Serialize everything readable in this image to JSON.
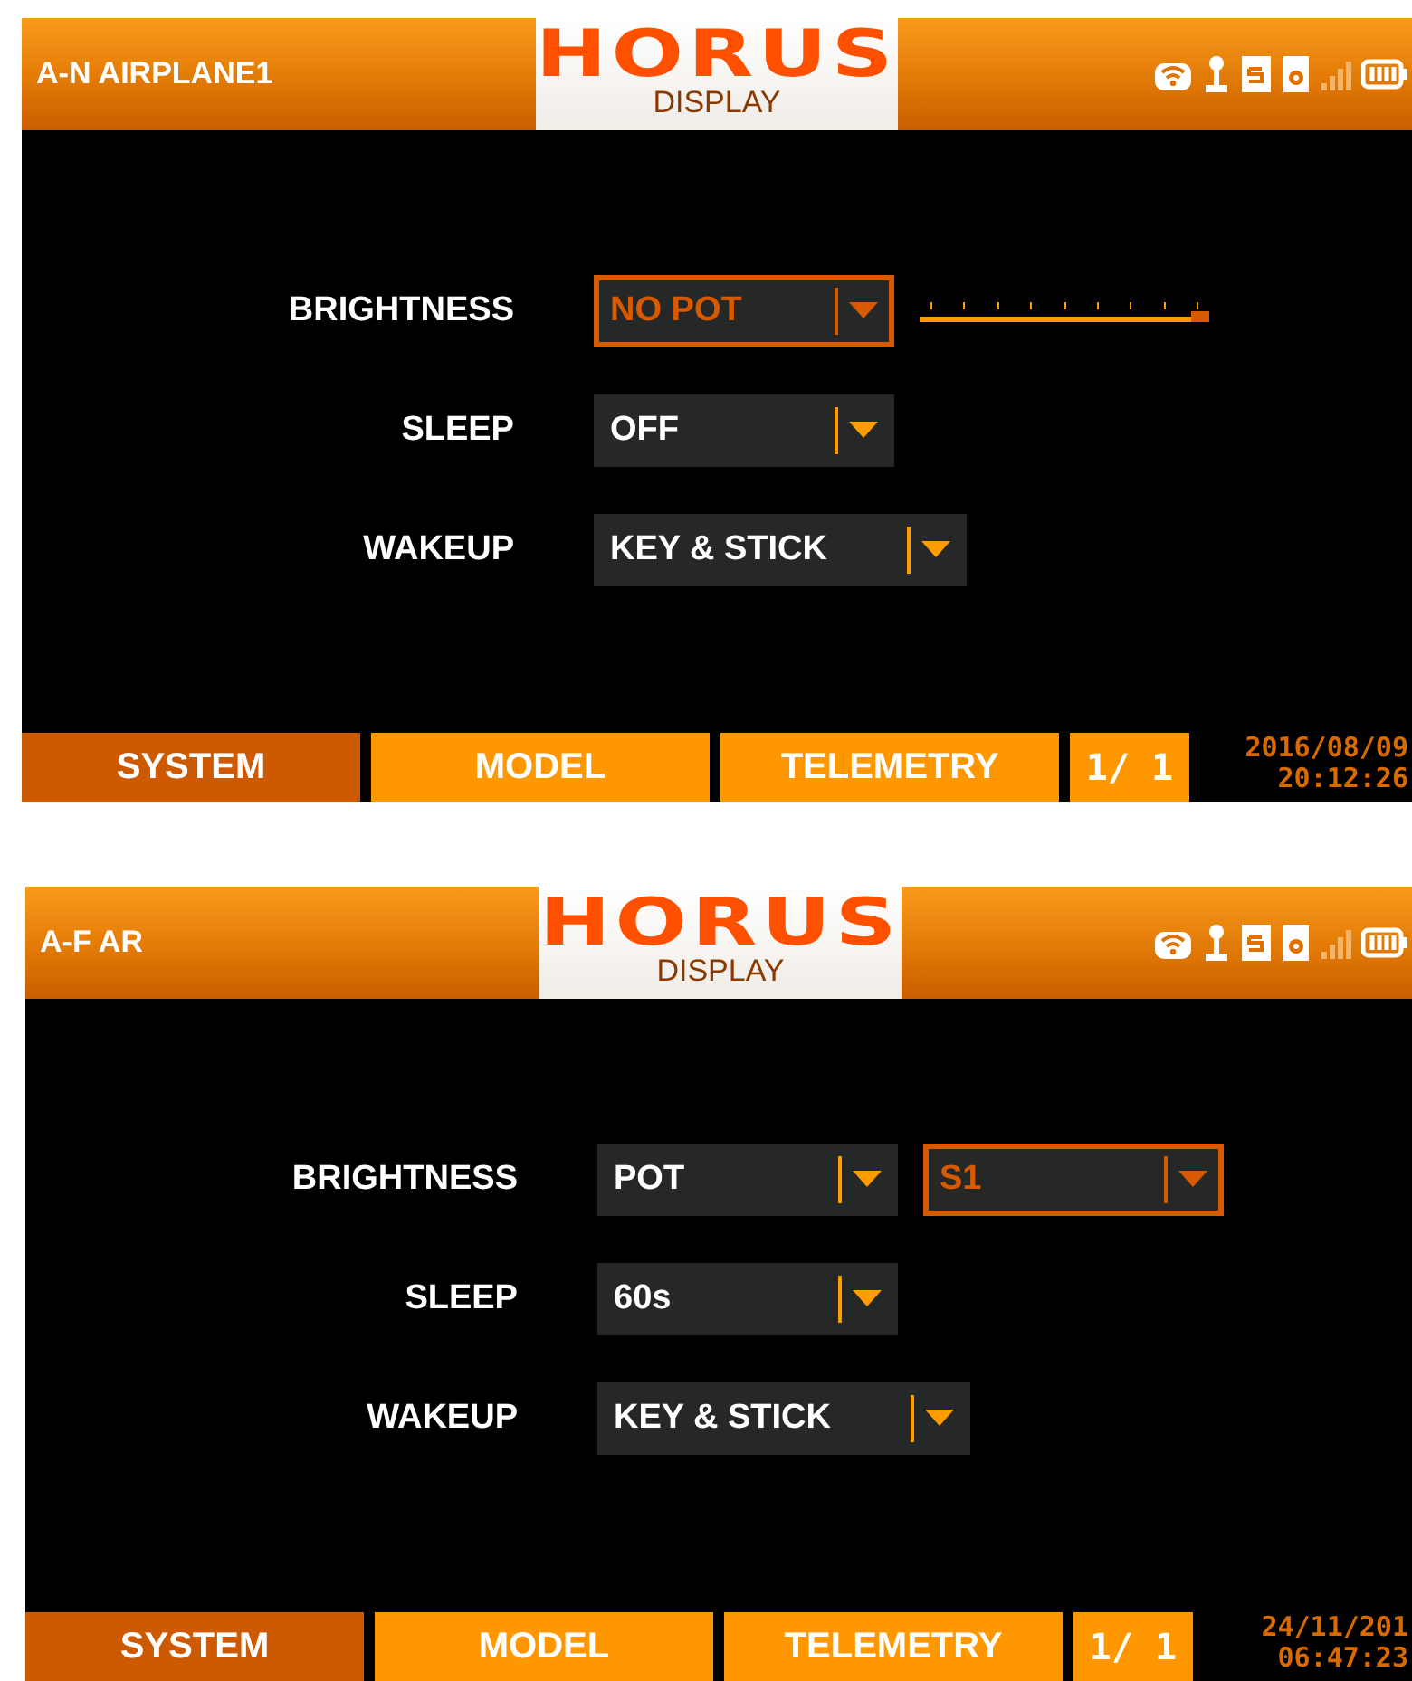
{
  "screens": [
    {
      "model_name": "A-N AIRPLANE1",
      "logo": "HORUS",
      "page_title": "DISPLAY",
      "settings": [
        {
          "label": "BRIGHTNESS",
          "controls": [
            {
              "kind": "dropdown",
              "value": "NO POT",
              "focused": true
            },
            {
              "kind": "slider",
              "level": 1
            }
          ]
        },
        {
          "label": "SLEEP",
          "controls": [
            {
              "kind": "dropdown",
              "value": "OFF",
              "focused": false
            }
          ]
        },
        {
          "label": "WAKEUP",
          "controls": [
            {
              "kind": "dropdown",
              "value": "KEY & STICK",
              "focused": false
            }
          ]
        }
      ],
      "tabs": [
        {
          "label": "SYSTEM",
          "selected": true
        },
        {
          "label": "MODEL",
          "selected": false
        },
        {
          "label": "TELEMETRY",
          "selected": false
        }
      ],
      "page": "1/ 1",
      "date": "2016/08/09",
      "time": "20:12:26"
    },
    {
      "model_name": "A-F AR",
      "logo": "HORUS",
      "page_title": "DISPLAY",
      "settings": [
        {
          "label": "BRIGHTNESS",
          "controls": [
            {
              "kind": "dropdown",
              "value": "POT",
              "focused": false
            },
            {
              "kind": "dropdown",
              "value": "S1",
              "focused": true
            }
          ]
        },
        {
          "label": "SLEEP",
          "controls": [
            {
              "kind": "dropdown",
              "value": "60s",
              "focused": false
            }
          ]
        },
        {
          "label": "WAKEUP",
          "controls": [
            {
              "kind": "dropdown",
              "value": "KEY & STICK",
              "focused": false
            }
          ]
        }
      ],
      "tabs": [
        {
          "label": "SYSTEM",
          "selected": true
        },
        {
          "label": "MODEL",
          "selected": false
        },
        {
          "label": "TELEMETRY",
          "selected": false
        }
      ],
      "page": "1/ 1",
      "date": "24/11/201",
      "time": "06:47:23"
    }
  ]
}
